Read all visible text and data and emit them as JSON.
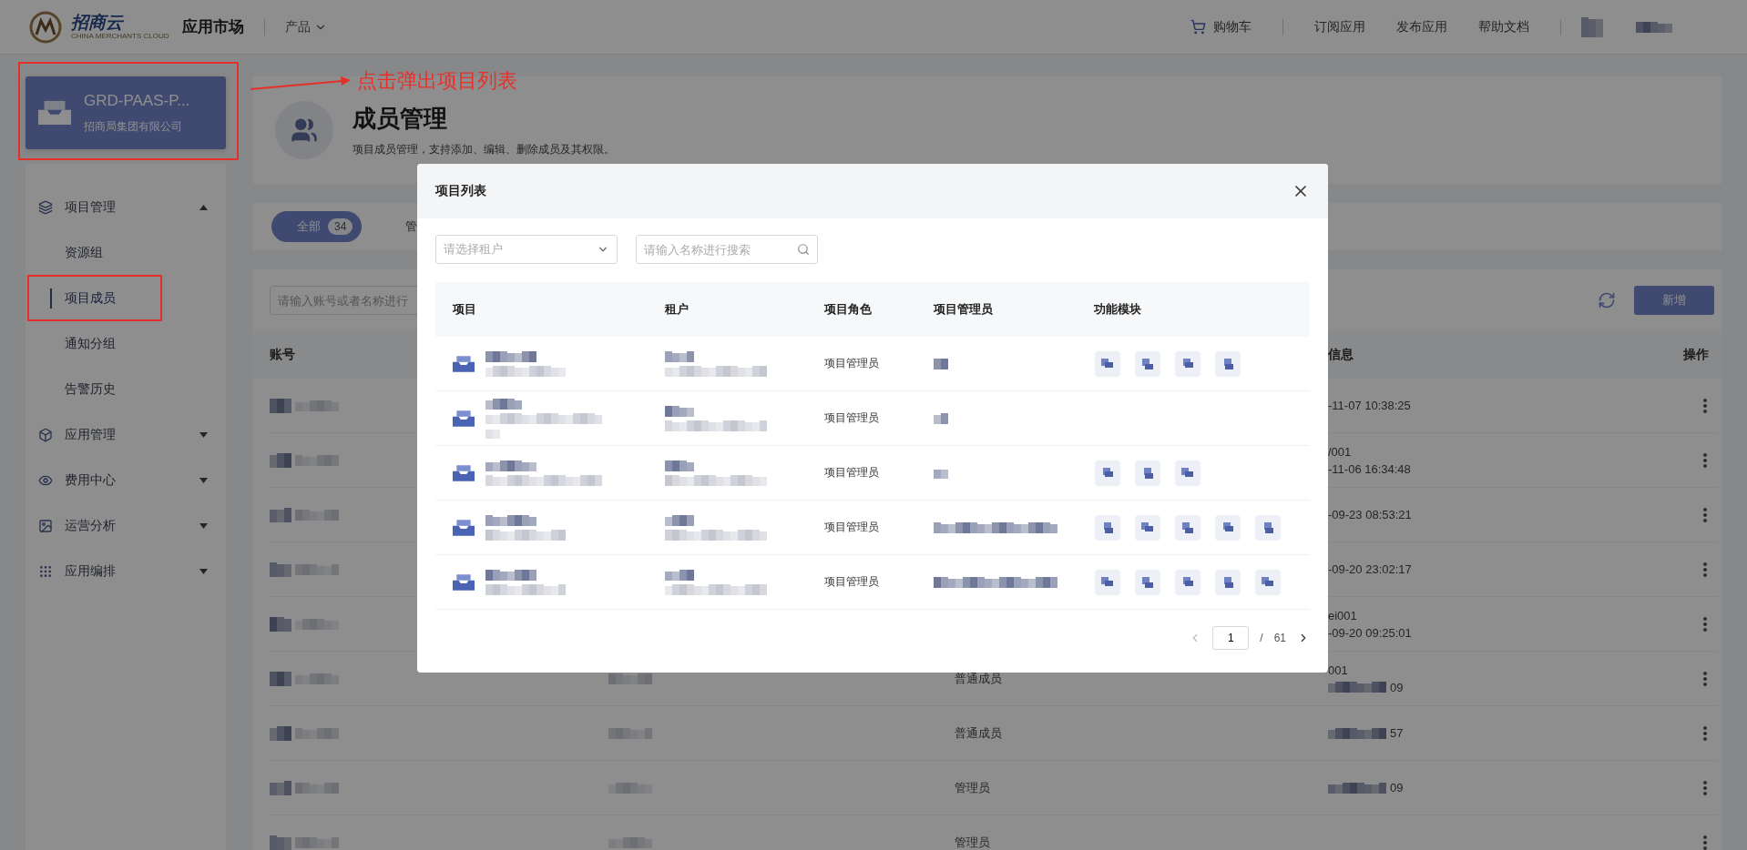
{
  "topbar": {
    "brand": "招商云",
    "brand_sub": "CHINA MERCHANTS CLOUD",
    "app": "应用市场",
    "menu": "产品",
    "links": [
      {
        "kind": "cart",
        "label": "购物车"
      },
      {
        "kind": "link",
        "label": "订阅应用"
      },
      {
        "kind": "link",
        "label": "发布应用"
      },
      {
        "kind": "link",
        "label": "帮助文档"
      }
    ]
  },
  "project_card": {
    "title": "GRD-PAAS-P...",
    "subtitle": "招商局集团有限公司"
  },
  "annotation": {
    "text": "点击弹出项目列表"
  },
  "sidebar": {
    "items": [
      {
        "kind": "layers",
        "label": "项目管理",
        "expanded": true,
        "children": [
          {
            "label": "资源组",
            "selected": false
          },
          {
            "label": "项目成员",
            "selected": true
          },
          {
            "label": "通知分组",
            "selected": false
          },
          {
            "label": "告警历史",
            "selected": false
          }
        ]
      },
      {
        "kind": "cube",
        "label": "应用管理",
        "expanded": false
      },
      {
        "kind": "eye",
        "label": "费用中心",
        "expanded": false
      },
      {
        "kind": "chart",
        "label": "运营分析",
        "expanded": false
      },
      {
        "kind": "grid",
        "label": "应用编排",
        "expanded": false
      }
    ]
  },
  "header": {
    "title": "成员管理",
    "description": "项目成员管理，支持添加、编辑、删除成员及其权限。"
  },
  "filter_tabs": [
    {
      "label": "全部",
      "count": "34",
      "selected": true
    },
    {
      "label": "管",
      "selected": false
    }
  ],
  "search": {
    "placeholder": "请输入账号或者名称进行"
  },
  "add_button": "新增",
  "members_table": {
    "columns": [
      "账号",
      "信息",
      "操作"
    ],
    "rows": [
      {
        "info": [
          "-11-07 10:38:25"
        ]
      },
      {
        "info": [
          "/001",
          "-11-06 16:34:48"
        ]
      },
      {
        "info": [
          "-09-23 08:53:21"
        ]
      },
      {
        "info": [
          "-09-20 23:02:17"
        ]
      },
      {
        "info": [
          "ei001",
          "-09-20 09:25:01"
        ]
      },
      {
        "role": "普通成员",
        "info": [
          "001",
          "09"
        ]
      },
      {
        "role": "普通成员",
        "info": [
          "57"
        ]
      },
      {
        "role": "管理员",
        "info": [
          "09"
        ]
      },
      {
        "role": "管理员",
        "info": []
      }
    ]
  },
  "modal": {
    "title": "项目列表",
    "tenant_select": {
      "placeholder": "请选择租户"
    },
    "search": {
      "placeholder": "请输入名称进行搜索"
    },
    "columns": [
      "项目",
      "租户",
      "项目角色",
      "项目管理员",
      "功能模块"
    ],
    "rows": [
      {
        "role": "项目管理员",
        "modules": [
          {
            "kind": "pixelated"
          },
          {
            "kind": "pixelated"
          },
          {
            "kind": "pixelated"
          },
          {
            "kind": "pixelated"
          }
        ]
      },
      {
        "role": "项目管理员",
        "modules": []
      },
      {
        "role": "项目管理员",
        "modules": [
          {
            "kind": "pixelated"
          },
          {
            "kind": "pixelated"
          },
          {
            "kind": "pixelated"
          }
        ]
      },
      {
        "role": "项目管理员",
        "modules": [
          {
            "kind": "pixelated"
          },
          {
            "kind": "pixelated"
          },
          {
            "kind": "pixelated"
          },
          {
            "kind": "pixelated"
          },
          {
            "kind": "pixelated"
          }
        ]
      },
      {
        "role": "项目管理员",
        "modules": [
          {
            "kind": "pixelated"
          },
          {
            "kind": "pixelated"
          },
          {
            "kind": "pixelated"
          },
          {
            "kind": "pixelated"
          },
          {
            "kind": "pixelated"
          }
        ]
      }
    ],
    "pagination": {
      "page": "1",
      "separator": "/",
      "total": "61"
    }
  }
}
